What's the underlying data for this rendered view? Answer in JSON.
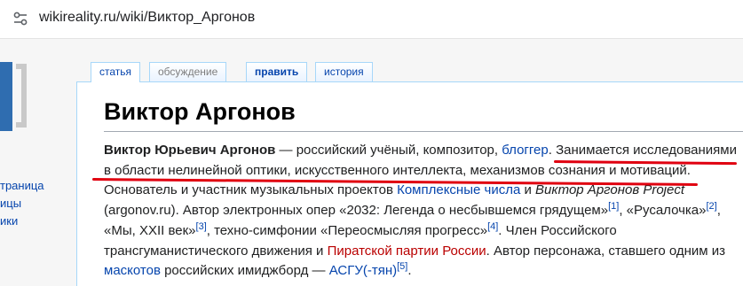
{
  "browser": {
    "url": "wikireality.ru/wiki/Виктор_Аргонов"
  },
  "sidebar": {
    "items": [
      "траница",
      "ицы",
      "ики"
    ]
  },
  "tabs": {
    "article": "статья",
    "discussion": "обсуждение",
    "edit": "править",
    "history": "история"
  },
  "page": {
    "title": "Виктор Аргонов",
    "p1_name": "Виктор Юрьевич Аргонов",
    "p1_a": " — российский учёный, композитор, ",
    "blogger_link": "блоггер",
    "p1_b": ". ",
    "p1_c": "Занимается исследованиями в области нелинейной оптики, искусственного интеллекта, механизмов сознания и мотиваций.",
    "p1_d": " Основатель и участник музыкальных проектов ",
    "complex_link": "Комплексные числа",
    "p1_e": " и ",
    "project_name": "Виктор Аргонов Project",
    "p1_f": " (argonov.ru). Автор электронных опер «2032: Легенда о несбывшемся грядущем»",
    "ref1": "[1]",
    "p1_g": ", «Русалочка»",
    "ref2": "[2]",
    "p1_h": ", «Мы, XXII век»",
    "ref3": "[3]",
    "p1_i": ", техно-симфонии «Переосмысляя прогресс»",
    "ref4": "[4]",
    "p1_j": ". Член Российского трансгуманистического движения и ",
    "pirate_link": "Пиратской партии России",
    "p1_k": ". Автор персонажа, ставшего одним из ",
    "mascots_link": "маскотов",
    "p1_l": " российских имиджборд — ",
    "asgu_link": "АСГУ(-тян)",
    "ref5": "[5]",
    "p1_m": "."
  },
  "colors": {
    "link": "#0645ad",
    "redlink": "#ba0000",
    "annotation": "#e00010"
  }
}
